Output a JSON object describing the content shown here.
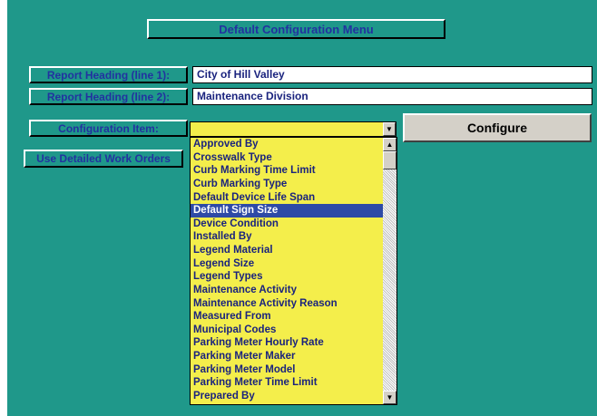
{
  "title": "Default Configuration Menu",
  "report_heading_1": {
    "label": "Report Heading (line 1):",
    "value": "City of Hill Valley"
  },
  "report_heading_2": {
    "label": "Report Heading (line 2):",
    "value": "Maintenance Division"
  },
  "configuration_item": {
    "label": "Configuration Item:",
    "value": ""
  },
  "configure_button": "Configure",
  "detailed_work_orders_button": "Use Detailed Work Orders",
  "dropdown": {
    "selected": "Default Sign Size",
    "items": [
      "Approved By",
      "Crosswalk Type",
      "Curb Marking Time Limit",
      "Curb Marking Type",
      "Default Device Life Span",
      "Default Sign Size",
      "Device Condition",
      "Installed By",
      "Legend Material",
      "Legend Size",
      "Legend Types",
      "Maintenance Activity",
      "Maintenance Activity Reason",
      "Measured From",
      "Municipal Codes",
      "Parking Meter Hourly Rate",
      "Parking Meter Maker",
      "Parking Meter Model",
      "Parking Meter Time Limit",
      "Prepared By"
    ]
  },
  "colors": {
    "form_background": "#1f988a",
    "label_text": "#2232a0",
    "list_background": "#f4ee4b",
    "selection": "#2e4aa6"
  },
  "icons": {
    "combo_arrow": "chevron-down-icon",
    "scroll_up": "scroll-up-icon",
    "scroll_down": "scroll-down-icon"
  }
}
